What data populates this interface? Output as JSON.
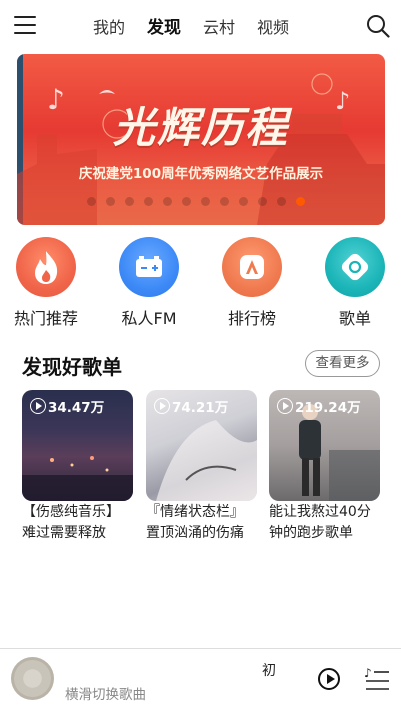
{
  "header": {
    "tabs": [
      {
        "label": "我的",
        "active": false
      },
      {
        "label": "发现",
        "active": true
      },
      {
        "label": "云村",
        "active": false
      },
      {
        "label": "视频",
        "active": false
      }
    ],
    "icons": {
      "menu": "menu-icon",
      "search": "search-icon"
    }
  },
  "banner": {
    "title": "光辉历程",
    "subtitle": "庆祝建党100周年优秀网络文艺作品展示",
    "dot_count": 12,
    "active_dot": 11,
    "accent_color": "#ff5a00"
  },
  "entries": [
    {
      "label": "热门推荐",
      "icon": "fire-icon",
      "color": "#f0654a"
    },
    {
      "label": "私人FM",
      "icon": "radio-icon",
      "color": "#3d8af7"
    },
    {
      "label": "排行榜",
      "icon": "rank-icon",
      "color": "#f07a50"
    },
    {
      "label": "歌单",
      "icon": "playlist-icon",
      "color": "#1bb5b8"
    }
  ],
  "playlists": {
    "title": "发现好歌单",
    "more_label": "查看更多",
    "items": [
      {
        "count": "34.47万",
        "name": "【伤感纯音乐】难过需要释放"
      },
      {
        "count": "74.21万",
        "name": "『情绪状态栏』置顶汹涌的伤痛"
      },
      {
        "count": "219.24万",
        "name": "能让我熬过40分钟的跑步歌单"
      }
    ]
  },
  "player": {
    "song_title": "初",
    "hint": "横滑切换歌曲",
    "icons": {
      "play": "play-icon",
      "list": "playlist-queue-icon"
    }
  }
}
